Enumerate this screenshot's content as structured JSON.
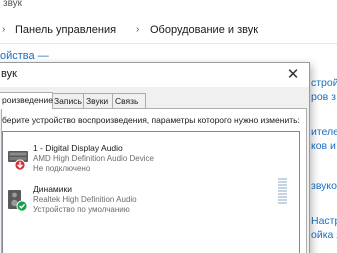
{
  "control_panel": {
    "window_title": "звук",
    "breadcrumb": [
      "Панель управления",
      "Оборудование и звук"
    ],
    "left_link": "ойства —",
    "right_links": [
      "стройк",
      "ров з",
      "ителей",
      "ков и",
      "звуко",
      "Настр",
      "ойка я"
    ]
  },
  "dialog": {
    "title": "вук",
    "close_icon": "close-icon",
    "tabs": [
      {
        "label": "роизведение",
        "active": true
      },
      {
        "label": "Запись",
        "active": false
      },
      {
        "label": "Звуки",
        "active": false
      },
      {
        "label": "Связь",
        "active": false
      }
    ],
    "instruction": "берите устройство воспроизведения, параметры которого нужно изменить:",
    "devices": [
      {
        "name": "1 - Digital Display Audio",
        "driver": "AMD High Definition Audio Device",
        "status": "Не подключено",
        "icon": "speaker-icon",
        "badge": "red-down-arrow",
        "badge_color": "#d13438"
      },
      {
        "name": "Динамики",
        "driver": "Realtek High Definition Audio",
        "status": "Устройство по умолчанию",
        "icon": "speaker-icon",
        "badge": "green-check",
        "badge_color": "#16a04a"
      }
    ]
  },
  "colors": {
    "link": "#1a6fc4",
    "dialog_bg": "#f0f0f0",
    "selected_tab_bg": "#ffffff"
  }
}
